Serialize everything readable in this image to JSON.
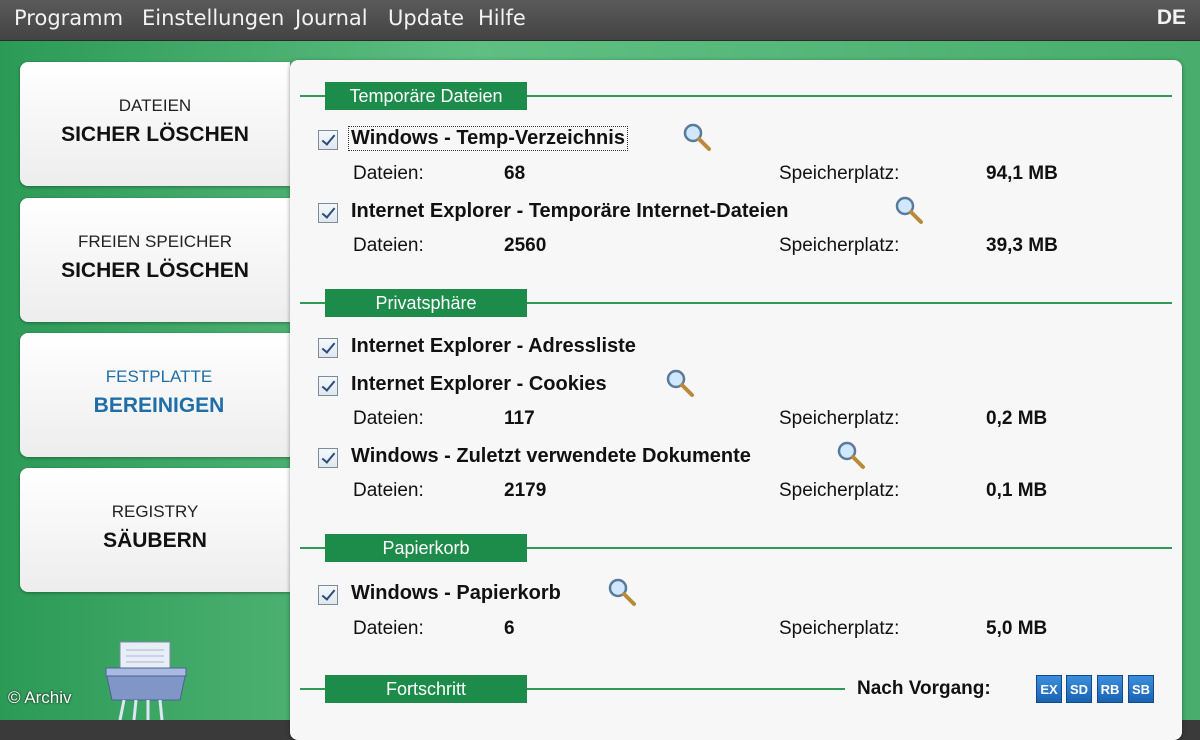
{
  "menu": [
    "Programm",
    "Einstellungen",
    "Journal",
    "Update",
    "Hilfe"
  ],
  "language": "DE",
  "sidebar": {
    "tabs": [
      {
        "line1": "DATEIEN",
        "line2": "SICHER LÖSCHEN",
        "active": false
      },
      {
        "line1": "FREIEN SPEICHER",
        "line2": "SICHER LÖSCHEN",
        "active": false
      },
      {
        "line1": "FESTPLATTE",
        "line2": "BEREINIGEN",
        "active": true
      },
      {
        "line1": "REGISTRY",
        "line2": "SÄUBERN",
        "active": false
      }
    ]
  },
  "labels": {
    "files": "Dateien:",
    "space": "Speicherplatz:"
  },
  "sections": {
    "temp": "Temporäre Dateien",
    "privacy": "Privatsphäre",
    "recycle": "Papierkorb",
    "progress": "Fortschritt"
  },
  "items": [
    {
      "title": "Windows - Temp-Verzeichnis",
      "checked": true,
      "files": "68",
      "space": "94,1 MB"
    },
    {
      "title": "Internet Explorer - Temporäre Internet-Dateien",
      "checked": true,
      "files": "2560",
      "space": "39,3 MB"
    },
    {
      "title": "Internet Explorer - Adressliste",
      "checked": true
    },
    {
      "title": "Internet Explorer - Cookies",
      "checked": true,
      "files": "117",
      "space": "0,2 MB"
    },
    {
      "title": "Windows - Zuletzt verwendete Dokumente",
      "checked": true,
      "files": "2179",
      "space": "0,1 MB"
    },
    {
      "title": "Windows - Papierkorb",
      "checked": true,
      "files": "6",
      "space": "5,0 MB"
    }
  ],
  "after": {
    "label": "Nach Vorgang:",
    "options": [
      "EX",
      "SD",
      "RB",
      "SB"
    ]
  },
  "watermark": "© Archiv",
  "colors": {
    "accent_green": "#1d8c4a",
    "active_blue": "#1f6ea8"
  }
}
